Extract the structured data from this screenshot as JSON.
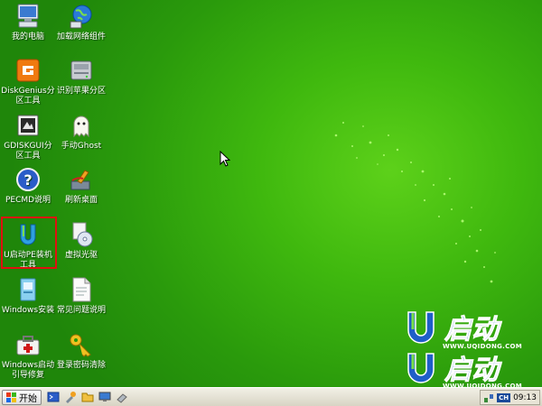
{
  "desktop": {
    "icons": [
      {
        "label": "我的电脑",
        "icon": "computer-icon"
      },
      {
        "label": "加载网络组件",
        "icon": "network-globe-icon"
      },
      {
        "label": "DiskGenius分区工具",
        "icon": "diskgenius-icon"
      },
      {
        "label": "识别苹果分区",
        "icon": "drive-icon"
      },
      {
        "label": "GDISKGUI分区工具",
        "icon": "gdisk-icon"
      },
      {
        "label": "手动Ghost",
        "icon": "ghost-icon"
      },
      {
        "label": "PECMD说明",
        "icon": "help-icon"
      },
      {
        "label": "刷新桌面",
        "icon": "brush-icon"
      },
      {
        "label": "U启动PE装机工具",
        "icon": "uqidong-installer-icon"
      },
      {
        "label": "虚拟光驱",
        "icon": "virtual-cd-icon"
      },
      {
        "label": "Windows安装",
        "icon": "windows-setup-icon"
      },
      {
        "label": "常见问题说明",
        "icon": "document-icon"
      },
      {
        "label": "Windows启动引导修复",
        "icon": "repair-toolbox-icon"
      },
      {
        "label": "登录密码清除",
        "icon": "key-icon"
      }
    ],
    "selected_icon": "U启动PE装机工具"
  },
  "logo": {
    "brand_text": "启动",
    "url_text": "WWW.UQIDONG.COM",
    "accent": "#1f5fc8"
  },
  "taskbar": {
    "start_label": "开始",
    "quick_launch": [
      "pecmd-icon",
      "tools-icon",
      "folder-icon",
      "monitor-icon",
      "eraser-icon"
    ],
    "tray": {
      "input_indicator": "CH",
      "clock": "09:13"
    }
  }
}
